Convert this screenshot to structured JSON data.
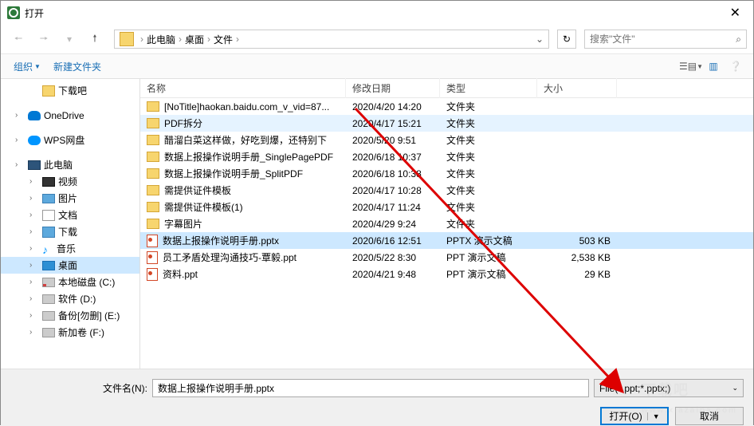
{
  "window": {
    "title": "打开"
  },
  "breadcrumb": {
    "items": [
      "此电脑",
      "桌面",
      "文件"
    ]
  },
  "search": {
    "placeholder": "搜索\"文件\""
  },
  "toolbar": {
    "organize": "组织",
    "newfolder": "新建文件夹"
  },
  "sidebar": {
    "items": [
      {
        "label": "下载吧",
        "icon": "folder",
        "indent": true,
        "children": false
      },
      {
        "label": "OneDrive",
        "icon": "onedrive",
        "indent": false,
        "children": true
      },
      {
        "label": "WPS网盘",
        "icon": "wps",
        "indent": false,
        "children": true
      },
      {
        "label": "此电脑",
        "icon": "pc",
        "indent": false,
        "children": true
      },
      {
        "label": "视频",
        "icon": "video",
        "indent": true,
        "children": true
      },
      {
        "label": "图片",
        "icon": "img",
        "indent": true,
        "children": true
      },
      {
        "label": "文档",
        "icon": "doc",
        "indent": true,
        "children": true
      },
      {
        "label": "下载",
        "icon": "dl",
        "indent": true,
        "children": true
      },
      {
        "label": "音乐",
        "icon": "music",
        "indent": true,
        "children": true
      },
      {
        "label": "桌面",
        "icon": "desktop",
        "indent": true,
        "children": true,
        "active": true
      },
      {
        "label": "本地磁盘 (C:)",
        "icon": "diskred",
        "indent": true,
        "children": true
      },
      {
        "label": "软件 (D:)",
        "icon": "disk",
        "indent": true,
        "children": true
      },
      {
        "label": "备份[勿删] (E:)",
        "icon": "disk",
        "indent": true,
        "children": true
      },
      {
        "label": "新加卷 (F:)",
        "icon": "disk",
        "indent": true,
        "children": true
      }
    ]
  },
  "columns": {
    "name": "名称",
    "date": "修改日期",
    "type": "类型",
    "size": "大小"
  },
  "files": [
    {
      "name": "[NoTitle]haokan.baidu.com_v_vid=87...",
      "date": "2020/4/20 14:20",
      "type": "文件夹",
      "size": "",
      "icon": "folder"
    },
    {
      "name": "PDF拆分",
      "date": "2020/4/17 15:21",
      "type": "文件夹",
      "size": "",
      "icon": "folder",
      "hover": true
    },
    {
      "name": "醋溜白菜这样做，好吃到爆，还特别下",
      "date": "2020/5/20 9:51",
      "type": "文件夹",
      "size": "",
      "icon": "folder"
    },
    {
      "name": "数据上报操作说明手册_SinglePagePDF",
      "date": "2020/6/18 10:37",
      "type": "文件夹",
      "size": "",
      "icon": "folder"
    },
    {
      "name": "数据上报操作说明手册_SplitPDF",
      "date": "2020/6/18 10:38",
      "type": "文件夹",
      "size": "",
      "icon": "folder"
    },
    {
      "name": "需提供证件模板",
      "date": "2020/4/17 10:28",
      "type": "文件夹",
      "size": "",
      "icon": "folder"
    },
    {
      "name": "需提供证件模板(1)",
      "date": "2020/4/17 11:24",
      "type": "文件夹",
      "size": "",
      "icon": "folder"
    },
    {
      "name": "字幕图片",
      "date": "2020/4/29 9:24",
      "type": "文件夹",
      "size": "",
      "icon": "folder"
    },
    {
      "name": "数据上报操作说明手册.pptx",
      "date": "2020/6/16 12:51",
      "type": "PPTX 演示文稿",
      "size": "503 KB",
      "icon": "ppt",
      "selected": true
    },
    {
      "name": "员工矛盾处理沟通技巧-覃毅.ppt",
      "date": "2020/5/22 8:30",
      "type": "PPT 演示文稿",
      "size": "2,538 KB",
      "icon": "ppt"
    },
    {
      "name": "资料.ppt",
      "date": "2020/4/21 9:48",
      "type": "PPT 演示文稿",
      "size": "29 KB",
      "icon": "ppt"
    }
  ],
  "footer": {
    "filename_label": "文件名(N):",
    "filename_value": "数据上报操作说明手册.pptx",
    "filter": "File(*.ppt;*.pptx;)",
    "open": "打开(O)",
    "cancel": "取消"
  }
}
